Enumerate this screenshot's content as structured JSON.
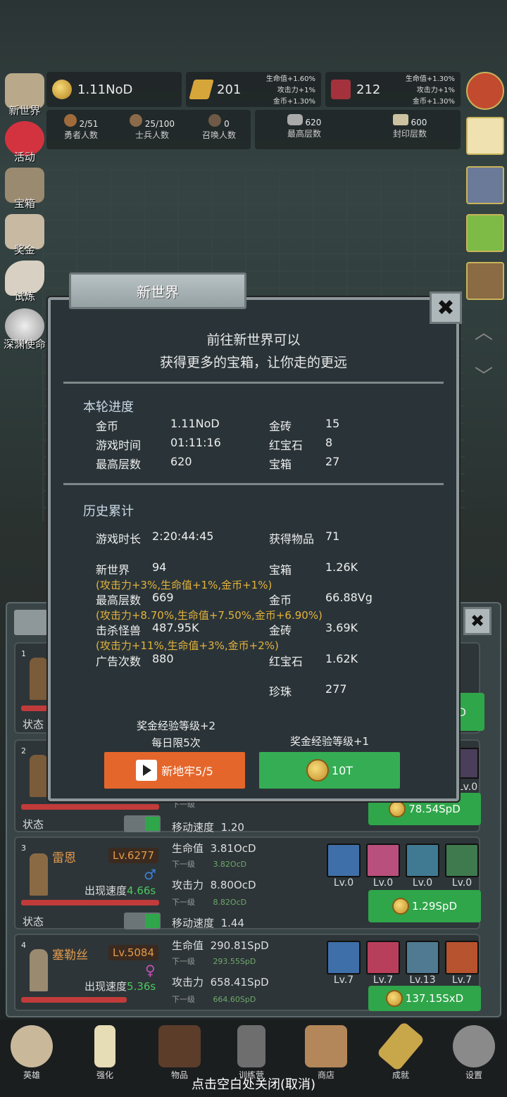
{
  "top": {
    "gold": "1.11NoD",
    "brick": "201",
    "brick_bonus": [
      "生命值+1.60%",
      "攻击力+1%",
      "金币+1.30%"
    ],
    "ruby": "212",
    "ruby_bonus": [
      "生命值+1.30%",
      "攻击力+1%",
      "金币+1.30%"
    ],
    "hero_count": "2/51",
    "hero_label": "勇者人数",
    "soldier_count": "25/100",
    "soldier_label": "士兵人数",
    "summon_count": "0",
    "summon_label": "召唤人数",
    "max_floor": "620",
    "max_floor_label": "最高层数",
    "seal_floor": "600",
    "seal_floor_label": "封印层数"
  },
  "side_left": [
    "新世界",
    "活动",
    "宝箱",
    "奖金",
    "试炼",
    "深渊使命"
  ],
  "modal": {
    "title": "新世界",
    "close": "✖",
    "intro1": "前往新世界可以",
    "intro2": "获得更多的宝箱，让你走的更远",
    "round_title": "本轮进度",
    "round": {
      "gold_k": "金币",
      "gold_v": "1.11NoD",
      "brick_k": "金砖",
      "brick_v": "15",
      "time_k": "游戏时间",
      "time_v": "01:11:16",
      "ruby_k": "红宝石",
      "ruby_v": "8",
      "floor_k": "最高层数",
      "floor_v": "620",
      "chest_k": "宝箱",
      "chest_v": "27"
    },
    "history_title": "历史累计",
    "history": {
      "dur_k": "游戏时长",
      "dur_v": "2:20:44:45",
      "items_k": "获得物品",
      "items_v": "71",
      "nw_k": "新世界",
      "nw_v": "94",
      "chest_k": "宝箱",
      "chest_v": "1.26K",
      "nw_bonus": "(攻击力+3%,生命值+1%,金币+1%)",
      "floor_k": "最高层数",
      "floor_v": "669",
      "gold_k": "金币",
      "gold_v": "66.88Vg",
      "floor_bonus": "(攻击力+8.70%,生命值+7.50%,金币+6.90%)",
      "kill_k": "击杀怪兽",
      "kill_v": "487.95K",
      "brick_k": "金砖",
      "brick_v": "3.69K",
      "kill_bonus": "(攻击力+11%,生命值+3%,金币+2%)",
      "ads_k": "广告次数",
      "ads_v": "880",
      "ruby_k": "红宝石",
      "ruby_v": "1.62K",
      "pearl_k": "珍珠",
      "pearl_v": "277"
    },
    "left_note1": "奖金经验等级+2",
    "left_note2": "每日限5次",
    "left_btn": "新地牢5/5",
    "right_note": "奖金经验等级+1",
    "right_btn": "10T"
  },
  "heroes": [
    {
      "idx": "1",
      "state": "状态"
    },
    {
      "idx": "2",
      "state": "状态",
      "next": "下一级",
      "speed_label": "移动速度",
      "speed": "1.20",
      "btn": "78.54SpD"
    },
    {
      "idx": "3",
      "name": "雷恩",
      "lv": "Lv.6277",
      "appear_label": "出现速度",
      "appear": "4.66s",
      "hp_label": "生命值",
      "hp": "3.81OcD",
      "hp_next_label": "下一级",
      "hp_next": "3.82OcD",
      "atk_label": "攻击力",
      "atk": "8.80OcD",
      "atk_next_label": "下一级",
      "atk_next": "8.82OcD",
      "speed_label": "移动速度",
      "speed": "1.44",
      "state": "状态",
      "skills": [
        "Lv.0",
        "Lv.0",
        "Lv.0",
        "Lv.0"
      ],
      "btn": "1.29SpD"
    },
    {
      "idx": "4",
      "name": "塞勒丝",
      "lv": "Lv.5084",
      "appear_label": "出现速度",
      "appear": "5.36s",
      "hp_label": "生命值",
      "hp": "290.81SpD",
      "hp_next_label": "下一级",
      "hp_next": "293.55SpD",
      "atk_label": "攻击力",
      "atk": "658.41SpD",
      "atk_next_label": "下一级",
      "atk_next": "664.60SpD",
      "skills": [
        "Lv.7",
        "Lv.7",
        "Lv.13",
        "Lv.7"
      ],
      "btn": "137.15SxD"
    }
  ],
  "partial": {
    "lv0": "Lv.0",
    "d": "D"
  },
  "nav": [
    "英雄",
    "强化",
    "物品",
    "训练营",
    "商店",
    "成就",
    "设置"
  ],
  "close_hint": "点击空白处关闭(取消)"
}
